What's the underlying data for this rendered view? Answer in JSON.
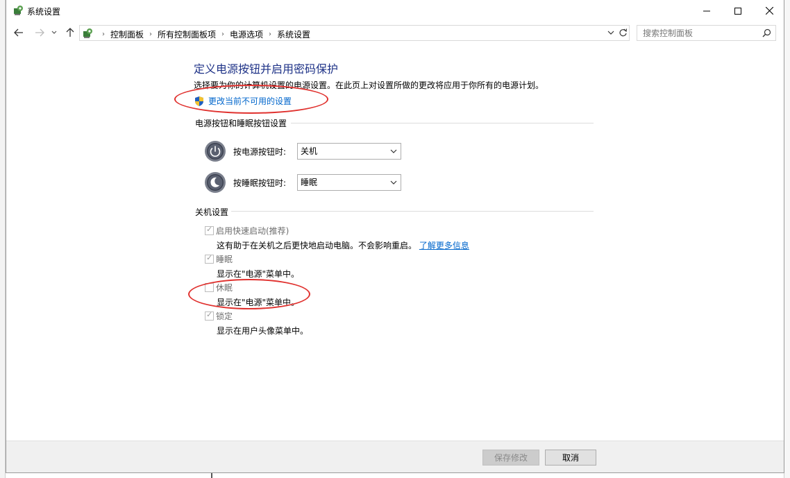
{
  "window": {
    "title": "系统设置",
    "minimize_icon": "minimize-icon",
    "maximize_icon": "maximize-icon",
    "close_icon": "close-icon"
  },
  "nav": {
    "breadcrumbs": [
      "控制面板",
      "所有控制面板项",
      "电源选项",
      "系统设置"
    ],
    "search_placeholder": "搜索控制面板"
  },
  "page": {
    "heading": "定义电源按钮并启用密码保护",
    "subtext": "选择要为你的计算机设置的电源设置。在此页上对设置所做的更改将应用于你所有的电源计划。",
    "change_link": "更改当前不可用的设置"
  },
  "power_section": {
    "title": "电源按钮和睡眠按钮设置",
    "power_button_label": "按电源按钮时:",
    "power_button_value": "关机",
    "sleep_button_label": "按睡眠按钮时:",
    "sleep_button_value": "睡眠"
  },
  "shutdown_section": {
    "title": "关机设置",
    "options": [
      {
        "label": "启用快速启动(推荐)",
        "desc": "这有助于在关机之后更快地启动电脑。不会影响重启。",
        "link": "了解更多信息",
        "checked": true
      },
      {
        "label": "睡眠",
        "desc": "显示在\"电源\"菜单中。",
        "checked": true
      },
      {
        "label": "休眠",
        "desc": "显示在\"电源\"菜单中。",
        "checked": false
      },
      {
        "label": "锁定",
        "desc": "显示在用户头像菜单中。",
        "checked": true
      }
    ]
  },
  "footer": {
    "save_label": "保存修改",
    "cancel_label": "取消"
  },
  "colors": {
    "heading": "#1e3287",
    "link": "#0066cc",
    "annotation": "#e0312e"
  }
}
